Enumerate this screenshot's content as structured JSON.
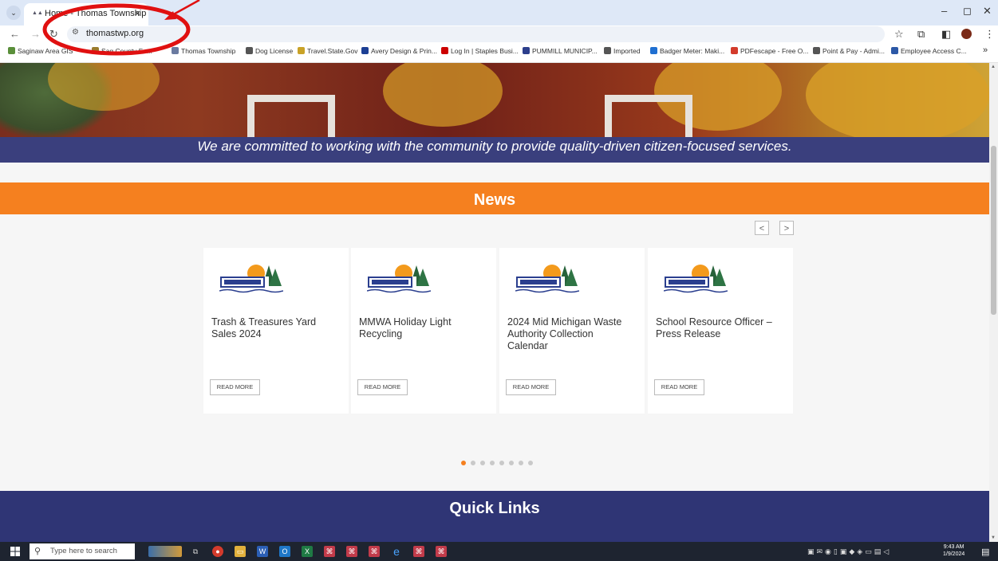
{
  "browser": {
    "tab": {
      "title": "Home - Thomas Township",
      "favicon": "township-favicon"
    },
    "window_controls": {
      "minimize": "–",
      "restore": "◻",
      "close": "✕"
    },
    "url": "thomastwp.org",
    "bookmarks": [
      {
        "label": "Saginaw Area GIS",
        "icon": "map-icon",
        "color": "#5a8f3a"
      },
      {
        "label": "Sag County Fo...",
        "icon": "seal-icon",
        "color": "#9a7b2d"
      },
      {
        "label": "Thomas Township",
        "icon": "township-favicon",
        "color": "#6a7aa0"
      },
      {
        "label": "Dog License",
        "icon": "globe-icon",
        "color": "#555555"
      },
      {
        "label": "Travel.State.Gov",
        "icon": "globe-icon",
        "color": "#c9a227"
      },
      {
        "label": "Avery Design & Prin...",
        "icon": "avery-icon",
        "color": "#1c3f94"
      },
      {
        "label": "Log In | Staples Busi...",
        "icon": "staples-icon",
        "color": "#cc0000"
      },
      {
        "label": "PUMMILL MUNICIP...",
        "icon": "search-icon",
        "color": "#2c3e8c"
      },
      {
        "label": "Imported",
        "icon": "folder-icon",
        "color": "#555555"
      },
      {
        "label": "Badger Meter: Maki...",
        "icon": "badger-icon",
        "color": "#1f6fd1"
      },
      {
        "label": "PDFescape - Free O...",
        "icon": "pdf-icon",
        "color": "#d33b2c"
      },
      {
        "label": "Point & Pay - Admi...",
        "icon": "globe-icon",
        "color": "#555555"
      },
      {
        "label": "Employee Access C...",
        "icon": "employee-icon",
        "color": "#2c58a6"
      }
    ],
    "bookmarks_overflow": "»"
  },
  "page": {
    "tagline": "We are committed to working with the community to provide quality-driven citizen-focused services.",
    "news": {
      "heading": "News",
      "prev_label": "<",
      "next_label": ">",
      "items": [
        {
          "title": "Trash & Treasures Yard Sales 2024",
          "button": "READ MORE"
        },
        {
          "title": "MMWA Holiday Light Recycling",
          "button": "READ MORE"
        },
        {
          "title": "2024 Mid Michigan Waste Authority Collection Calendar",
          "button": "READ MORE"
        },
        {
          "title": "School Resource Officer – Press Release",
          "button": "READ MORE"
        }
      ],
      "pager_count": 8,
      "pager_active": 0
    },
    "quick_links": {
      "heading": "Quick Links"
    }
  },
  "colors": {
    "accent_orange": "#f5801f",
    "navy": "#3a3f7d",
    "annotation_red": "#e01010"
  },
  "taskbar": {
    "search_placeholder": "Type here to search",
    "time": "9:43 AM",
    "date": "1/9/2024"
  }
}
